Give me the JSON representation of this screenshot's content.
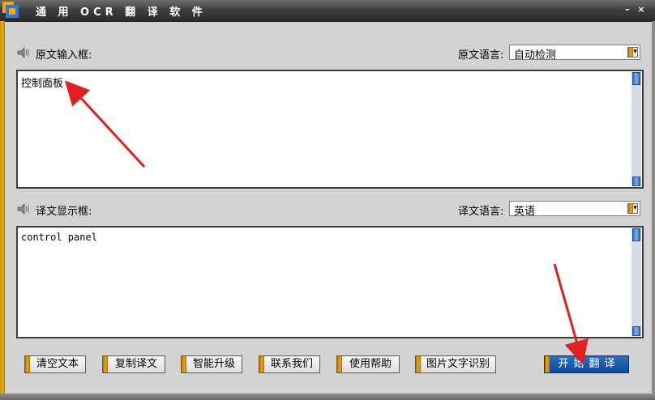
{
  "window": {
    "title": "通 用 OCR 翻 译 软 件",
    "minimize_glyph": "–",
    "close_glyph": "×"
  },
  "source": {
    "label": "原文输入框:",
    "lang_label": "原文语言:",
    "lang_value": "自动检测",
    "text": "控制面板"
  },
  "target": {
    "label": "译文显示框:",
    "lang_label": "译文语言:",
    "lang_value": "英语",
    "text": "control panel"
  },
  "buttons": {
    "clear": "清空文本",
    "copy": "复制译文",
    "upgrade": "智能升级",
    "contact": "联系我们",
    "help": "使用帮助",
    "ocr": "图片文字识别",
    "translate": "开始翻译"
  },
  "colors": {
    "accent_gold": "#f2b600",
    "primary_blue": "#1a5aa8",
    "arrow_red": "#e02020"
  }
}
